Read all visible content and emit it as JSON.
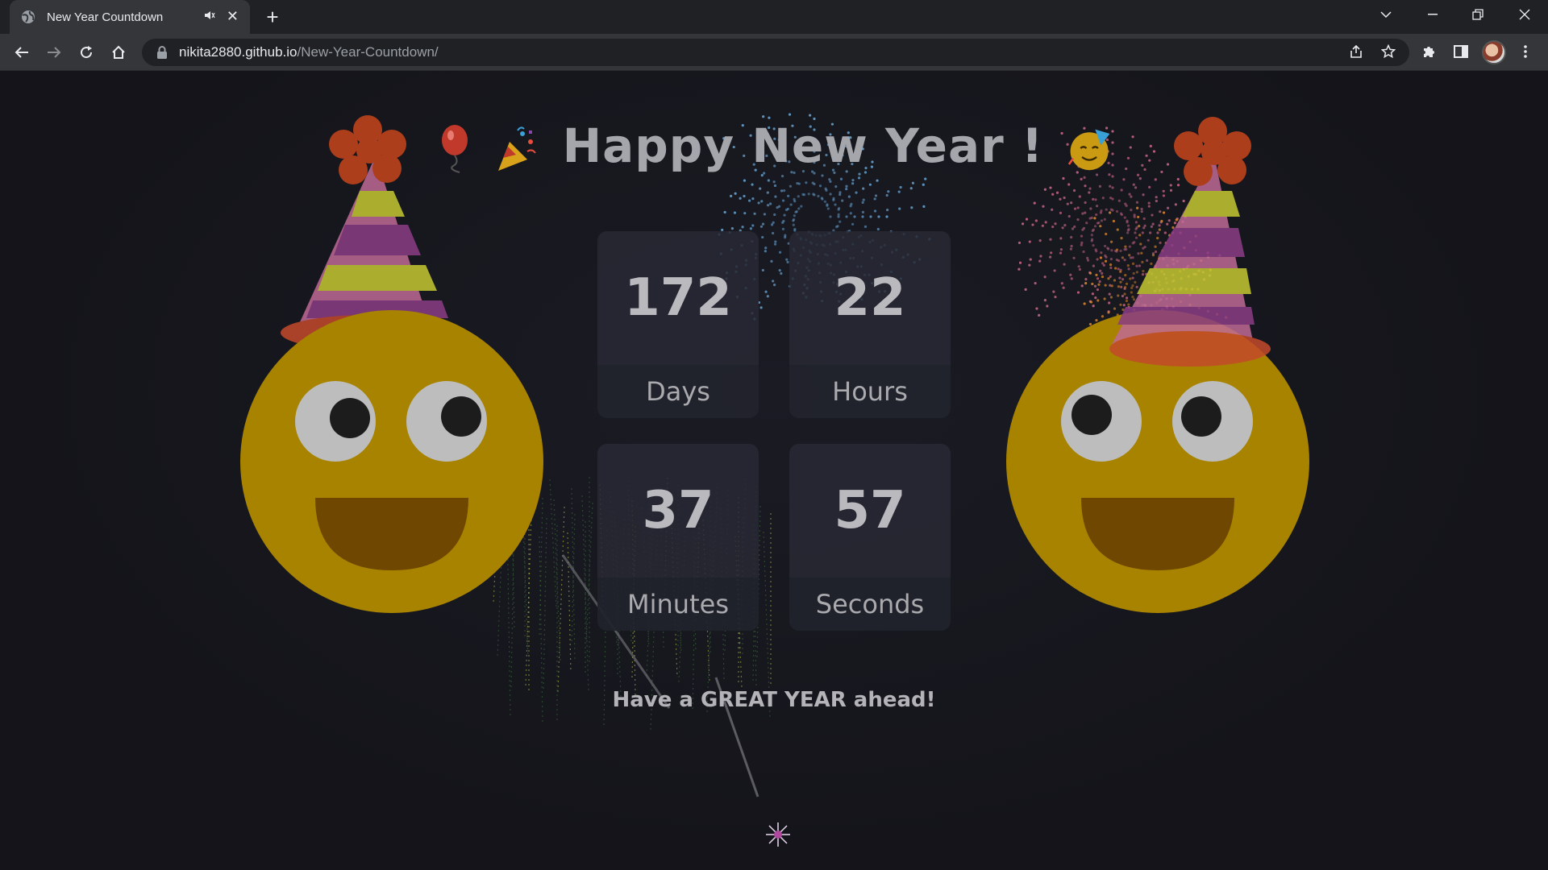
{
  "browser": {
    "tab_title": "New Year Countdown",
    "url_host": "nikita2880.github.io",
    "url_path": "/New-Year-Countdown/"
  },
  "page": {
    "title": "Happy New Year !",
    "countdown": [
      {
        "value": "172",
        "label": "Days"
      },
      {
        "value": "22",
        "label": "Hours"
      },
      {
        "value": "37",
        "label": "Minutes"
      },
      {
        "value": "57",
        "label": "Seconds"
      }
    ],
    "tagline": "Have a GREAT YEAR ahead!"
  },
  "icons": {
    "title_left": [
      "balloon-icon",
      "party-popper-icon"
    ],
    "title_right": "partying-face-icon",
    "decor": [
      "party-hat-smiley-left",
      "party-hat-smiley-right",
      "sparkler-icon"
    ]
  },
  "colors": {
    "background": "#15151c",
    "box": "#282934",
    "smiley": "#a88300",
    "text": "#b9b9be"
  }
}
